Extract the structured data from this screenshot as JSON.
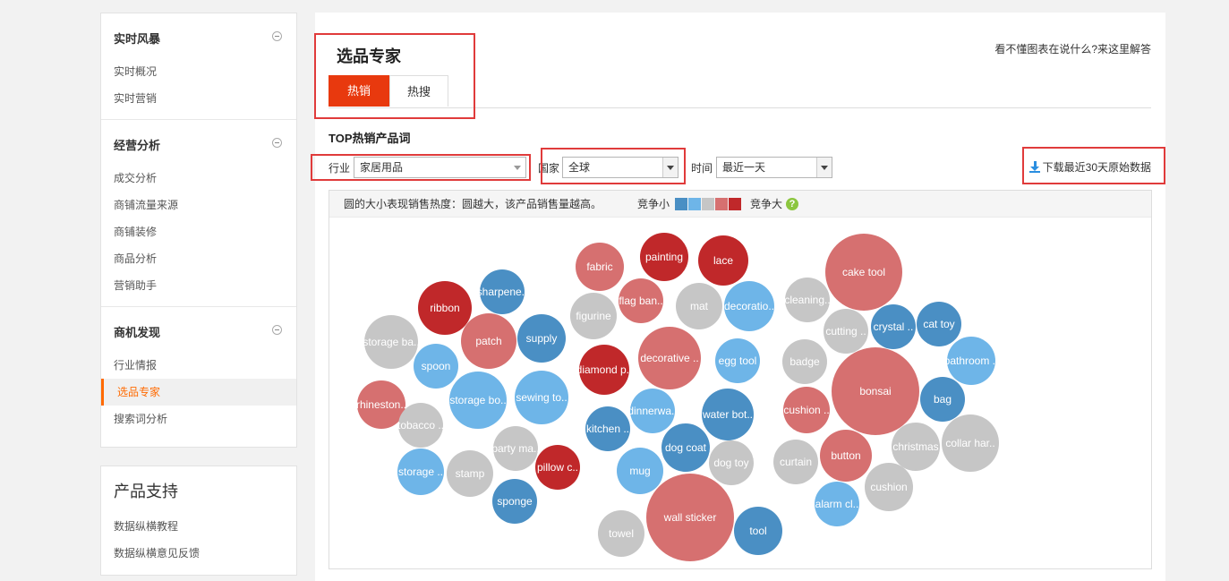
{
  "sidebar": {
    "groups": [
      {
        "title": "实时风暴",
        "items": [
          "实时概况",
          "实时营销"
        ]
      },
      {
        "title": "经营分析",
        "items": [
          "成交分析",
          "商铺流量来源",
          "商铺装修",
          "商品分析",
          "营销助手"
        ]
      },
      {
        "title": "商机发现",
        "items": [
          "行业情报",
          "选品专家",
          "搜索词分析"
        ]
      }
    ],
    "active_item": "选品专家",
    "support": {
      "title": "产品支持",
      "items": [
        "数据纵横教程",
        "数据纵横意见反馈"
      ]
    }
  },
  "main": {
    "title": "选品专家",
    "help_link": "看不懂图表在说什么?来这里解答",
    "tabs": [
      {
        "label": "热销",
        "active": true
      },
      {
        "label": "热搜",
        "active": false
      }
    ],
    "section_title": "TOP热销产品词",
    "filters": {
      "industry": {
        "label": "行业",
        "value": "家居用品"
      },
      "country": {
        "label": "国家",
        "value": "全球"
      },
      "time": {
        "label": "时间",
        "value": "最近一天"
      }
    },
    "download_label": "下载最近30天原始数据",
    "legend": {
      "note": "圆的大小表现销售热度：圆越大，该产品销售量越高。",
      "low_label": "竞争小",
      "high_label": "竞争大",
      "colors": [
        "#4a8fc4",
        "#6eb5e8",
        "#c6c6c6",
        "#d67070",
        "#c0282a"
      ]
    }
  },
  "colors": {
    "accent": "#e8390e",
    "active_nav": "#ff6a00",
    "annotation_red": "#e03b3b"
  },
  "chart_data": {
    "type": "bubble",
    "size_meaning": "销售热度",
    "color_meaning": "竞争程度",
    "color_scale": [
      {
        "level": 1,
        "color": "#4a8fc4"
      },
      {
        "level": 2,
        "color": "#6eb5e8"
      },
      {
        "level": 3,
        "color": "#c6c6c6"
      },
      {
        "level": 4,
        "color": "#d67070"
      },
      {
        "level": 5,
        "color": "#c0282a"
      }
    ],
    "bubbles": [
      {
        "label": "ribbon",
        "competition": 5,
        "size": 30
      },
      {
        "label": "sharpene..",
        "competition": 1,
        "size": 25
      },
      {
        "label": "storage ba..",
        "competition": 3,
        "size": 30
      },
      {
        "label": "patch",
        "competition": 4,
        "size": 31
      },
      {
        "label": "supply",
        "competition": 1,
        "size": 27
      },
      {
        "label": "spoon",
        "competition": 2,
        "size": 25
      },
      {
        "label": "rhineston..",
        "competition": 4,
        "size": 27
      },
      {
        "label": "storage bo..",
        "competition": 2,
        "size": 32
      },
      {
        "label": "sewing to..",
        "competition": 2,
        "size": 30
      },
      {
        "label": "tobacco ..",
        "competition": 3,
        "size": 25
      },
      {
        "label": "party ma..",
        "competition": 3,
        "size": 25
      },
      {
        "label": "storage ..",
        "competition": 2,
        "size": 26
      },
      {
        "label": "stamp",
        "competition": 3,
        "size": 26
      },
      {
        "label": "pillow c..",
        "competition": 5,
        "size": 25
      },
      {
        "label": "sponge",
        "competition": 1,
        "size": 25
      },
      {
        "label": "fabric",
        "competition": 4,
        "size": 27
      },
      {
        "label": "painting",
        "competition": 5,
        "size": 27
      },
      {
        "label": "lace",
        "competition": 5,
        "size": 28
      },
      {
        "label": "figurine",
        "competition": 3,
        "size": 26
      },
      {
        "label": "flag ban..",
        "competition": 4,
        "size": 25
      },
      {
        "label": "mat",
        "competition": 3,
        "size": 26
      },
      {
        "label": "decoratio..",
        "competition": 2,
        "size": 28
      },
      {
        "label": "diamond p..",
        "competition": 5,
        "size": 28
      },
      {
        "label": "decorative ..",
        "competition": 4,
        "size": 35
      },
      {
        "label": "egg tool",
        "competition": 2,
        "size": 25
      },
      {
        "label": "kitchen ..",
        "competition": 1,
        "size": 25
      },
      {
        "label": "dinnerwa..",
        "competition": 2,
        "size": 25
      },
      {
        "label": "water bot..",
        "competition": 1,
        "size": 29
      },
      {
        "label": "dog coat",
        "competition": 1,
        "size": 27
      },
      {
        "label": "dog toy",
        "competition": 3,
        "size": 25
      },
      {
        "label": "mug",
        "competition": 2,
        "size": 26
      },
      {
        "label": "wall sticker",
        "competition": 4,
        "size": 49
      },
      {
        "label": "towel",
        "competition": 3,
        "size": 26
      },
      {
        "label": "tool",
        "competition": 1,
        "size": 27
      },
      {
        "label": "cake tool",
        "competition": 4,
        "size": 43
      },
      {
        "label": "cleaning..",
        "competition": 3,
        "size": 25
      },
      {
        "label": "cutting ..",
        "competition": 3,
        "size": 25
      },
      {
        "label": "crystal ..",
        "competition": 1,
        "size": 25
      },
      {
        "label": "cat toy",
        "competition": 1,
        "size": 25
      },
      {
        "label": "bathroom ..",
        "competition": 2,
        "size": 27
      },
      {
        "label": "badge",
        "competition": 3,
        "size": 25
      },
      {
        "label": "bonsai",
        "competition": 4,
        "size": 49
      },
      {
        "label": "bag",
        "competition": 1,
        "size": 25
      },
      {
        "label": "cushion ..",
        "competition": 4,
        "size": 26
      },
      {
        "label": "christmas",
        "competition": 3,
        "size": 27
      },
      {
        "label": "collar har..",
        "competition": 3,
        "size": 32
      },
      {
        "label": "curtain",
        "competition": 3,
        "size": 25
      },
      {
        "label": "button",
        "competition": 4,
        "size": 29
      },
      {
        "label": "cushion",
        "competition": 3,
        "size": 27
      },
      {
        "label": "alarm cl..",
        "competition": 2,
        "size": 25
      }
    ]
  }
}
